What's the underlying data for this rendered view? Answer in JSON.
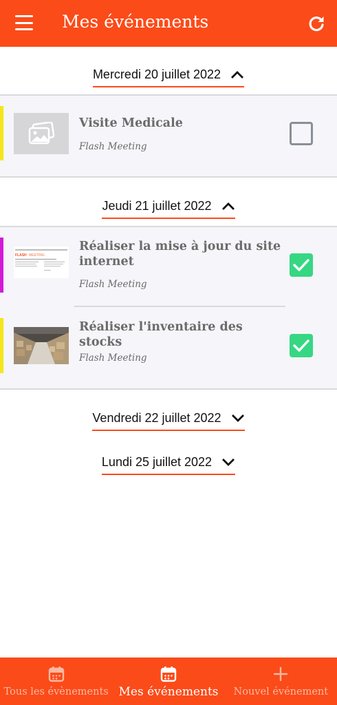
{
  "header": {
    "title": "Mes événements",
    "menu_icon": "menu-icon",
    "refresh_icon": "refresh-icon"
  },
  "colors": {
    "primary": "#fb4b19",
    "check_green": "#36d783",
    "event_bg": "#f5f5fa",
    "bar_yellow": "#f5e61a",
    "bar_magenta": "#d21ad8"
  },
  "groups": [
    {
      "date": "Mercredi 20 juillet 2022",
      "expanded": true,
      "events": [
        {
          "title": "Visite Medicale",
          "subtitle": "Flash Meeting",
          "checked": false,
          "thumbnail": "image-placeholder-icon"
        }
      ]
    },
    {
      "date": "Jeudi 21 juillet 2022",
      "expanded": true,
      "events": [
        {
          "title": "Réaliser la mise à jour du site internet",
          "subtitle": "Flash Meeting",
          "checked": true,
          "thumbnail": "document-preview"
        },
        {
          "title": "Réaliser l'inventaire des stocks",
          "subtitle": "Flash Meeting",
          "checked": true,
          "thumbnail": "warehouse-photo"
        }
      ]
    },
    {
      "date": "Vendredi 22 juillet 2022",
      "expanded": false,
      "events": []
    },
    {
      "date": "Lundi 25 juillet 2022",
      "expanded": false,
      "events": []
    }
  ],
  "thumb_doc": {
    "heading": "FLASH MEETING METTEZ EN LES COLLABORATEURS D'AUJOURD'HUI",
    "brand_a": "FLASH",
    "brand_b": "MEETING"
  },
  "nav": [
    {
      "label": "Tous les évènements",
      "icon": "calendar-icon",
      "active": false
    },
    {
      "label": "Mes événements",
      "icon": "calendar-icon",
      "active": true
    },
    {
      "label": "Nouvel événement",
      "icon": "plus-icon",
      "active": false
    }
  ]
}
